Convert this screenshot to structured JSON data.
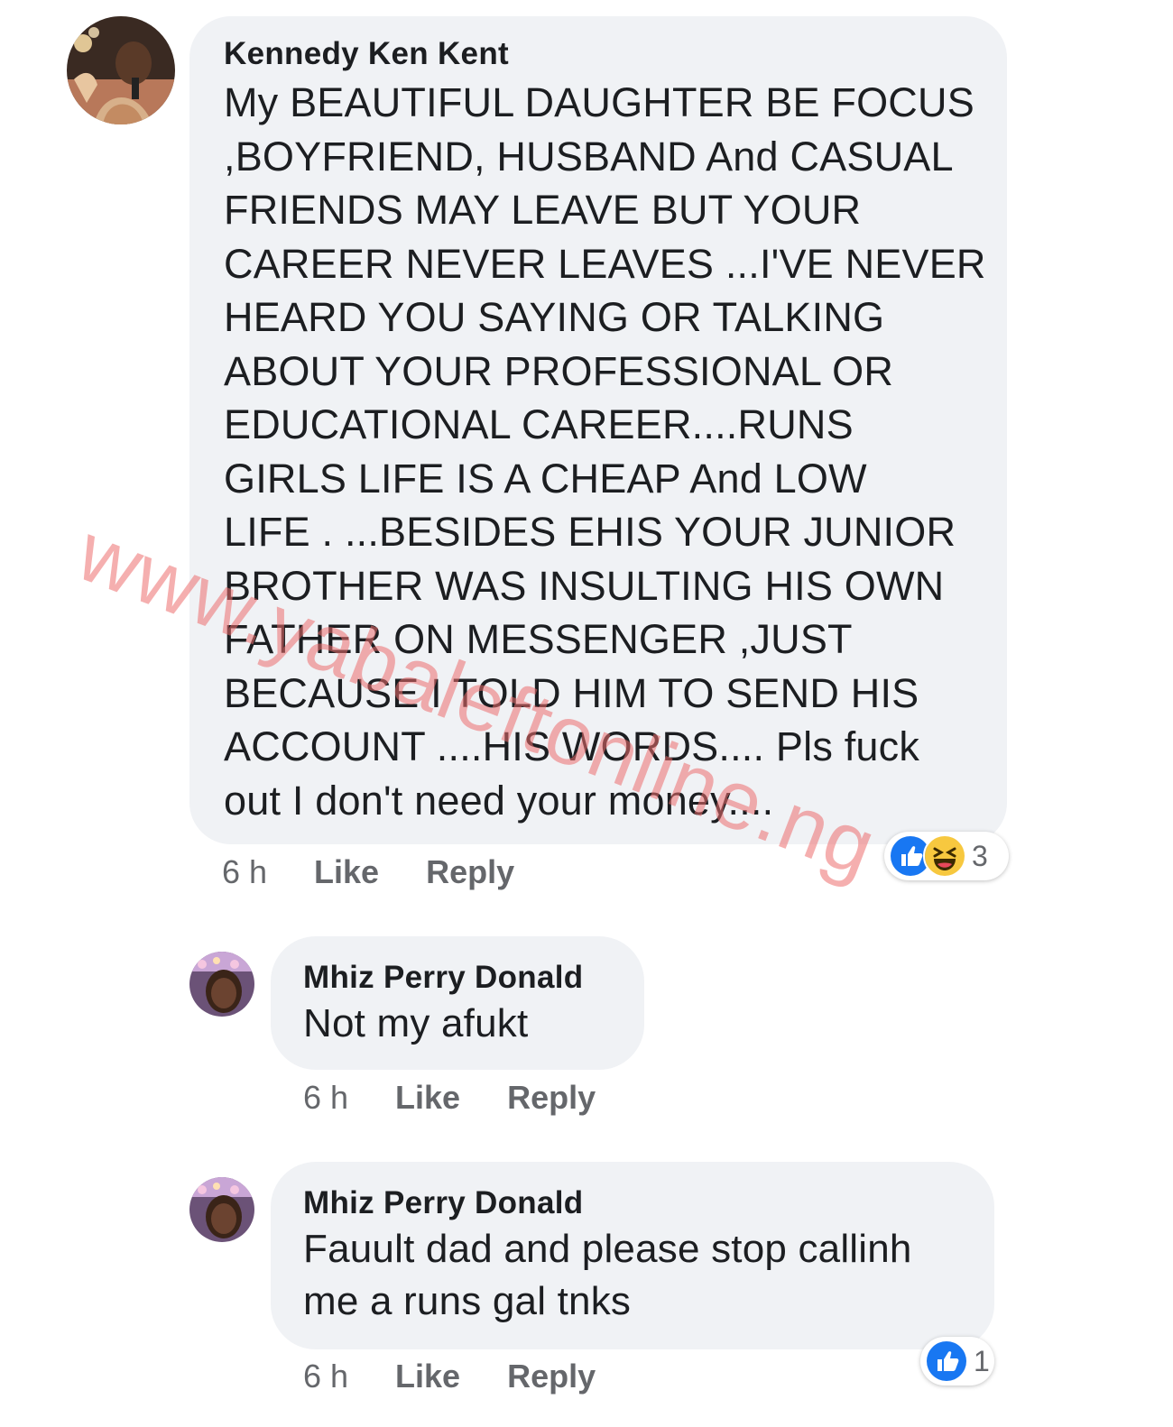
{
  "comments": [
    {
      "author": "Kennedy Ken Kent",
      "text": "My BEAUTIFUL DAUGHTER BE FOCUS\n,BOYFRIEND, HUSBAND And CASUAL\nFRIENDS MAY LEAVE BUT YOUR\nCAREER NEVER LEAVES ...I'VE NEVER\nHEARD YOU SAYING OR TALKING\nABOUT YOUR PROFESSIONAL OR\nEDUCATIONAL CAREER....RUNS\nGIRLS LIFE IS A CHEAP And LOW\nLIFE . ...BESIDES EHIS YOUR JUNIOR\nBROTHER WAS INSULTING HIS OWN\nFATHER ON MESSENGER ,JUST\nBECAUSE I TOLD HIM TO SEND HIS\nACCOUNT ....HIS WORDS.... Pls fuck\nout I don't need your money....",
      "time": "6 h",
      "like_label": "Like",
      "reply_label": "Reply",
      "reactions": [
        "like-icon",
        "haha-icon"
      ],
      "reaction_count": "3"
    },
    {
      "author": "Mhiz Perry Donald",
      "text": "Not my afukt",
      "time": "6 h",
      "like_label": "Like",
      "reply_label": "Reply"
    },
    {
      "author": "Mhiz Perry Donald",
      "text": "Fauult dad and please stop callinh\nme a runs gal tnks",
      "time": "6 h",
      "like_label": "Like",
      "reply_label": "Reply",
      "reactions": [
        "like-icon"
      ],
      "reaction_count": "1"
    }
  ],
  "watermark": "www.yabaleftonline.ng",
  "colors": {
    "bubble": "#f0f2f5",
    "text": "#1c1e21",
    "meta": "#65676b",
    "like_blue": "#1877f2",
    "haha_yellow": "#f7c83f",
    "watermark": "#ec6e6e"
  }
}
